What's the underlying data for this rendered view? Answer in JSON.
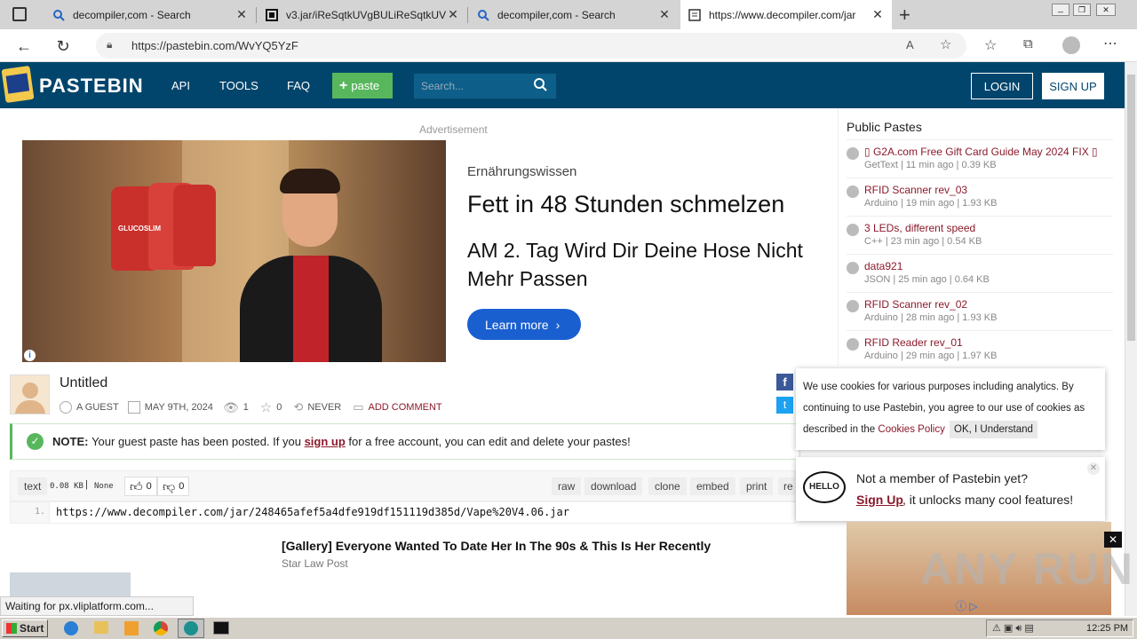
{
  "tabs": [
    {
      "title": "decompiler,com - Search"
    },
    {
      "title": "v3.jar/iReSqtkUVgBULiReSqtkUVg"
    },
    {
      "title": "decompiler,com - Search"
    },
    {
      "title": "https://www.decompiler.com/jar"
    }
  ],
  "address": {
    "url": "https://pastebin.com/WvYQ5YzF"
  },
  "header": {
    "logo": "PASTEBIN",
    "nav": [
      "API",
      "TOOLS",
      "FAQ"
    ],
    "paste_button": "paste",
    "search_placeholder": "Search...",
    "login": "LOGIN",
    "signup": "SIGN UP"
  },
  "ad": {
    "label": "Advertisement",
    "kicker": "Ernährungswissen",
    "headline": "Fett in 48 Stunden schmelzen",
    "subline": "AM 2. Tag Wird Dir Deine Hose Nicht Mehr Passen",
    "cta": "Learn more",
    "product": "GLUCOSLIM"
  },
  "paste": {
    "title": "Untitled",
    "author": "A GUEST",
    "date": "MAY 9TH, 2024",
    "views": "1",
    "stars": "0",
    "expire": "NEVER",
    "comment": "ADD COMMENT",
    "note_label": "NOTE:",
    "note_text": "Your guest paste has been posted. If you",
    "note_link": "sign up",
    "note_rest": "for a free account, you can edit and delete your pastes!",
    "format": "text",
    "size": "0.08 KB",
    "syntax": "None",
    "likes": "0",
    "dislikes": "0",
    "actions": [
      "raw",
      "download",
      "clone",
      "embed",
      "print",
      "re"
    ],
    "line_no": "1.",
    "line_text": "https://www.decompiler.com/jar/248465afef5a4dfe919df151119d385d/Vape%20V4.06.jar"
  },
  "public_pastes": {
    "heading": "Public Pastes",
    "items": [
      {
        "title": "▯ G2A.com Free Gift Card Guide May 2024 FIX ▯",
        "meta": "GetText | 11 min ago | 0.39 KB"
      },
      {
        "title": "RFID Scanner rev_03",
        "meta": "Arduino | 19 min ago | 1.93 KB"
      },
      {
        "title": "3 LEDs, different speed",
        "meta": "C++ | 23 min ago | 0.54 KB"
      },
      {
        "title": "data921",
        "meta": "JSON | 25 min ago | 0.64 KB"
      },
      {
        "title": "RFID Scanner rev_02",
        "meta": "Arduino | 28 min ago | 1.93 KB"
      },
      {
        "title": "RFID Reader rev_01",
        "meta": "Arduino | 29 min ago | 1.97 KB"
      }
    ]
  },
  "cookie": {
    "text": "We use cookies for various purposes including analytics. By continuing to use Pastebin, you agree to our use of cookies as described in the",
    "link": "Cookies Policy",
    "ok": "OK, I Understand"
  },
  "member": {
    "hello": "HELLO",
    "line1": "Not a member of Pastebin yet?",
    "link": "Sign Up",
    "line2": ", it unlocks many cool features!"
  },
  "bottom_ad": {
    "title": "[Gallery] Everyone Wanted To Date Her In The 90s & This Is Her Recently",
    "source": "Star Law Post"
  },
  "status": "Waiting for px.vliplatform.com...",
  "taskbar": {
    "start": "Start",
    "time": "12:25 PM"
  },
  "watermark": "ANY RUN",
  "colors": {
    "header": "#02456c",
    "paste_green": "#58b75c",
    "link": "#8b1a2b",
    "cta_blue": "#1a5fcf"
  }
}
